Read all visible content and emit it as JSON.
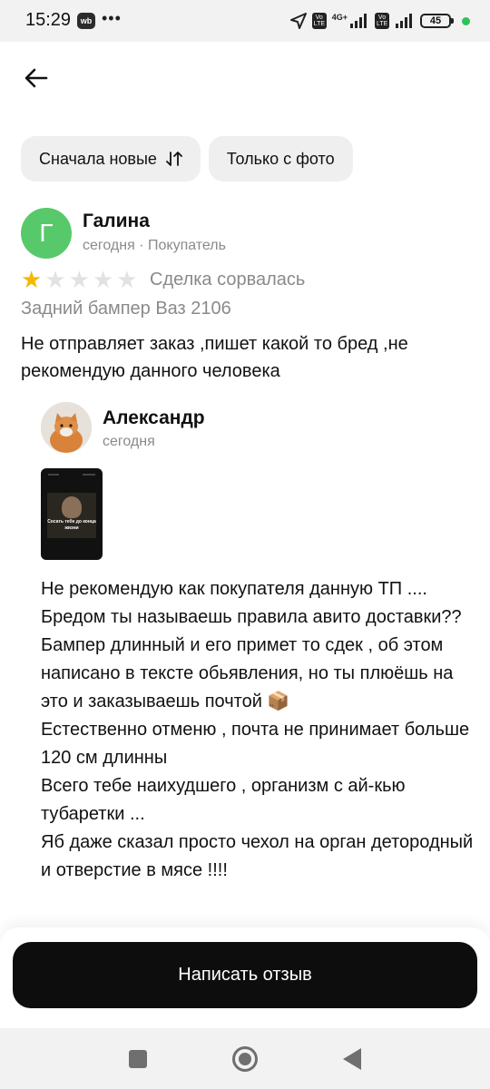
{
  "status_bar": {
    "time": "15:29",
    "app_badge": "wb",
    "more_dots": "•••",
    "network_type": "4G+",
    "volte_label": "Vo LTE",
    "battery_level": "45"
  },
  "header": {
    "back_icon": "arrow-left-icon"
  },
  "filters": {
    "sort_label": "Сначала новые",
    "sort_icon": "sort-arrows-icon",
    "photo_label": "Только с фото"
  },
  "review": {
    "avatar_letter": "Г",
    "avatar_color": "#57c96a",
    "author": "Галина",
    "meta": "сегодня · Покупатель",
    "rating": 1,
    "rating_max": 5,
    "star_color": "#f5b800",
    "deal_status": "Сделка сорвалась",
    "item_title": "Задний бампер Ваз 2106",
    "text": "Не отправляет заказ ,пишет какой то бред ,не рекомендую данного человека"
  },
  "reply": {
    "author": "Александр",
    "date": "сегодня",
    "image_caption": "Сосать тебе до конца жизни",
    "text": "Не рекомендую как покупателя данную ТП ....\nБредом ты называешь правила авито доставки??\nБампер длинный и его примет то сдек , об этом написано в тексте обьявления, но ты плюёшь на это и заказываешь почтой 📦\nЕстественно отменю , почта не принимает больше 120 см длинны\nВсего тебе наихудшего , организм с ай-кью тубаретки ...\nЯб даже сказал просто чехол на орган детородный и отверстие в мясе !!!!"
  },
  "actions": {
    "write_review_label": "Написать отзыв"
  },
  "nav_bar": {
    "recents_icon": "square-icon",
    "home_icon": "circle-home-icon",
    "back_icon": "triangle-back-icon"
  }
}
